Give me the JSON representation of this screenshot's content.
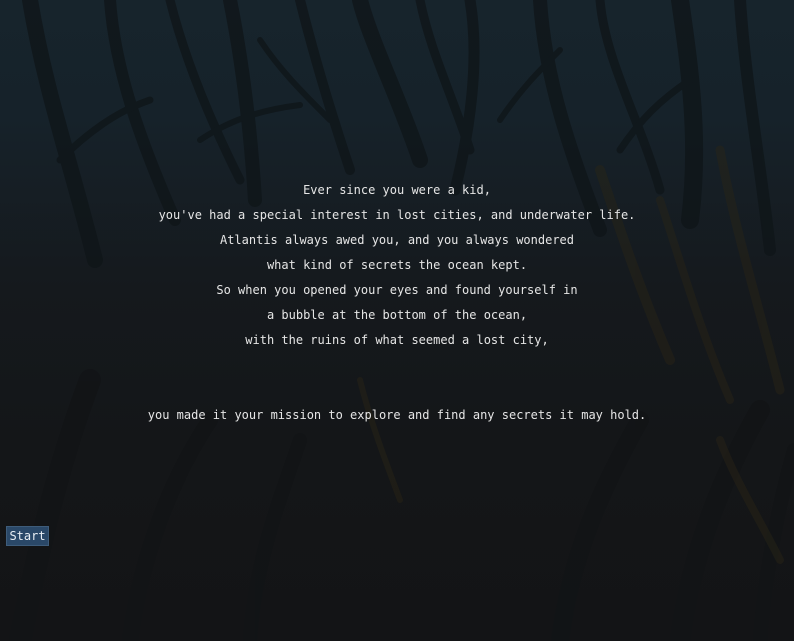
{
  "intro": {
    "lines": [
      "Ever since you were a kid,",
      "you've had a special interest in lost cities, and underwater life.",
      "Atlantis always awed you, and you always wondered",
      "what kind of secrets the ocean kept.",
      "So when you opened your eyes and found yourself in",
      "a bubble at the bottom of the ocean,",
      "with the ruins of what seemed a lost city,",
      "",
      "",
      "you made it your mission to explore and find any secrets it may hold."
    ]
  },
  "controls": {
    "start_label": "Start"
  },
  "colors": {
    "background_top": "#17242c",
    "background_bottom": "#131416",
    "text": "#e6e6e6",
    "button_fill": "#2a4868",
    "button_border": "#3e5c7a",
    "seaweed_dark": "#101416",
    "seaweed_accent": "#2b2516"
  }
}
